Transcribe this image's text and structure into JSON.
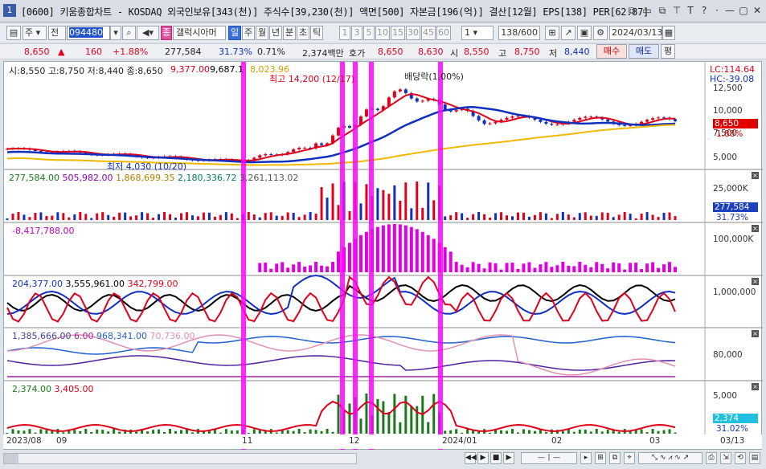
{
  "window": {
    "number": "1",
    "title": "[0600] 키움종합차트 - KOSDAQ 외국인보유[343(천)] 주식수[39,230(천)] 액면[500] 자본금[196(억)] 결산[12월] EPS[138] PER[62.87]",
    "controls": [
      "⧉",
      "▭",
      "⧉",
      "▭",
      "T",
      "?",
      "·",
      "—",
      "▢",
      "✕"
    ]
  },
  "toolbar": {
    "period_select": "주",
    "range_select": "전",
    "code": "094480",
    "stock_name": "갤럭시아머",
    "period_buttons": [
      "일",
      "주",
      "월",
      "년",
      "분",
      "초",
      "틱"
    ],
    "active_period": "일",
    "interval_buttons": [
      "1",
      "3",
      "5",
      "10",
      "15",
      "30",
      "45",
      "60"
    ],
    "interval_select": "1",
    "count": "138",
    "count_total": "/600",
    "date": "2024/03/13"
  },
  "quote": {
    "price": "8,650",
    "change_arrow": "▲",
    "change": "160",
    "change_pct": "+1.88%",
    "volume": "277,584",
    "volume_ratio": "31.73%",
    "turnover": "0.71%",
    "amount": "2,374백만",
    "hoga_label": "호가",
    "ask": "8,650",
    "bid": "8,630",
    "open_label": "시",
    "open": "8,550",
    "high_label": "고",
    "high": "8,750",
    "low_label": "저",
    "low": "8,440",
    "buy_label": "매수",
    "sell_label": "매도",
    "eval_label": "평"
  },
  "panels": {
    "price": {
      "ohlc": "시:8,550 고:8,750 저:8,440 종:8,650",
      "ma1": "9,377.00",
      "ma2": "9,687.1",
      "ma3": "8,023.96",
      "high_note": "최고 14,200 (12/17)",
      "low_note": "최저 4,030 (10/20)",
      "event_note": "배당락(1.00%)",
      "lc": "LC:114.64",
      "hc": "HC:-39.08",
      "ticks": [
        "12,500",
        "10,000",
        "7,500",
        "5,000"
      ],
      "current_tag": "8,650",
      "current_pct": "1.88%"
    },
    "volume": {
      "values": [
        "277,584.00",
        "505,982.00",
        "1,868,699.35",
        "2,180,336.72",
        "3,261,113.02"
      ],
      "ticks": [
        "25,000K"
      ],
      "current_tag": "277,584",
      "current_pct": "31.73%"
    },
    "indicator1": {
      "value": "-8,417,788.00",
      "ticks": [
        "100,000K"
      ]
    },
    "indicator2": {
      "values": [
        "204,377.00",
        "3,555,961.00",
        "342,799.00"
      ],
      "ticks": [
        "1,000,000"
      ]
    },
    "indicator3": {
      "values": [
        "1,385,666.00",
        "6.00",
        "968,341.00",
        "70,736.00"
      ],
      "ticks": [
        "80,000"
      ]
    },
    "amount": {
      "values": [
        "2,374.00",
        "3,405.00"
      ],
      "ticks": [
        "5,000"
      ],
      "current_tag": "2,374",
      "current_pct": "31.02%"
    }
  },
  "xaxis": [
    "2023/08",
    "09",
    "11",
    "12",
    "2024/01",
    "02",
    "03",
    "03/13"
  ],
  "colors": {
    "up": "#e0001a",
    "down": "#1030c0",
    "highlight": "#ff00ff",
    "ma_long": "#f0b800",
    "volume_bar": "#1a7a1a"
  }
}
